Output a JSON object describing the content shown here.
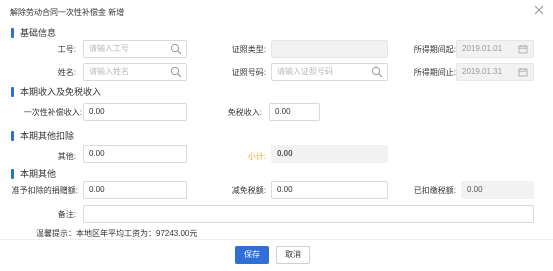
{
  "dialog": {
    "title": "解除劳动合同一次性补偿金 新增"
  },
  "sections": {
    "basic": "基础信息",
    "income": "本期收入及免税收入",
    "deduction": "本期其他扣除",
    "other": "本期其他"
  },
  "basic": {
    "job_no_label": "工号:",
    "job_no_placeholder": "请输入工号",
    "id_type_label": "证照类型:",
    "period_start_label": "所得期间起:",
    "period_start_value": "2019.01.01",
    "name_label": "姓名:",
    "name_placeholder": "请输入姓名",
    "id_no_label": "证照号码:",
    "id_no_placeholder": "请输入证照号码",
    "period_end_label": "所得期间止:",
    "period_end_value": "2019.01.31"
  },
  "income": {
    "compensation_label": "一次性补偿收入:",
    "compensation_value": "0.00",
    "tax_free_label": "免税收入:",
    "tax_free_value": "0.00"
  },
  "deduction": {
    "other_label": "其他:",
    "other_value": "0.00",
    "subtotal_label": "小计:",
    "subtotal_value": "0.00"
  },
  "other": {
    "donation_label": "准予扣除的捐赠额:",
    "donation_value": "0.00",
    "tax_reduction_label": "减免税额:",
    "tax_reduction_value": "0.00",
    "withheld_label": "已扣缴税额:",
    "withheld_value": "0.00",
    "remark_label": "备注:",
    "remark_value": ""
  },
  "tip": "温馨提示：本地区年平均工资为：97243.00元",
  "buttons": {
    "save": "保存",
    "cancel": "取消"
  },
  "colors": {
    "accent": "#2f6fd7",
    "subtotal": "#f5a623"
  },
  "icons": {
    "close": "close-icon",
    "search": "search-icon",
    "calendar": "calendar-icon"
  }
}
